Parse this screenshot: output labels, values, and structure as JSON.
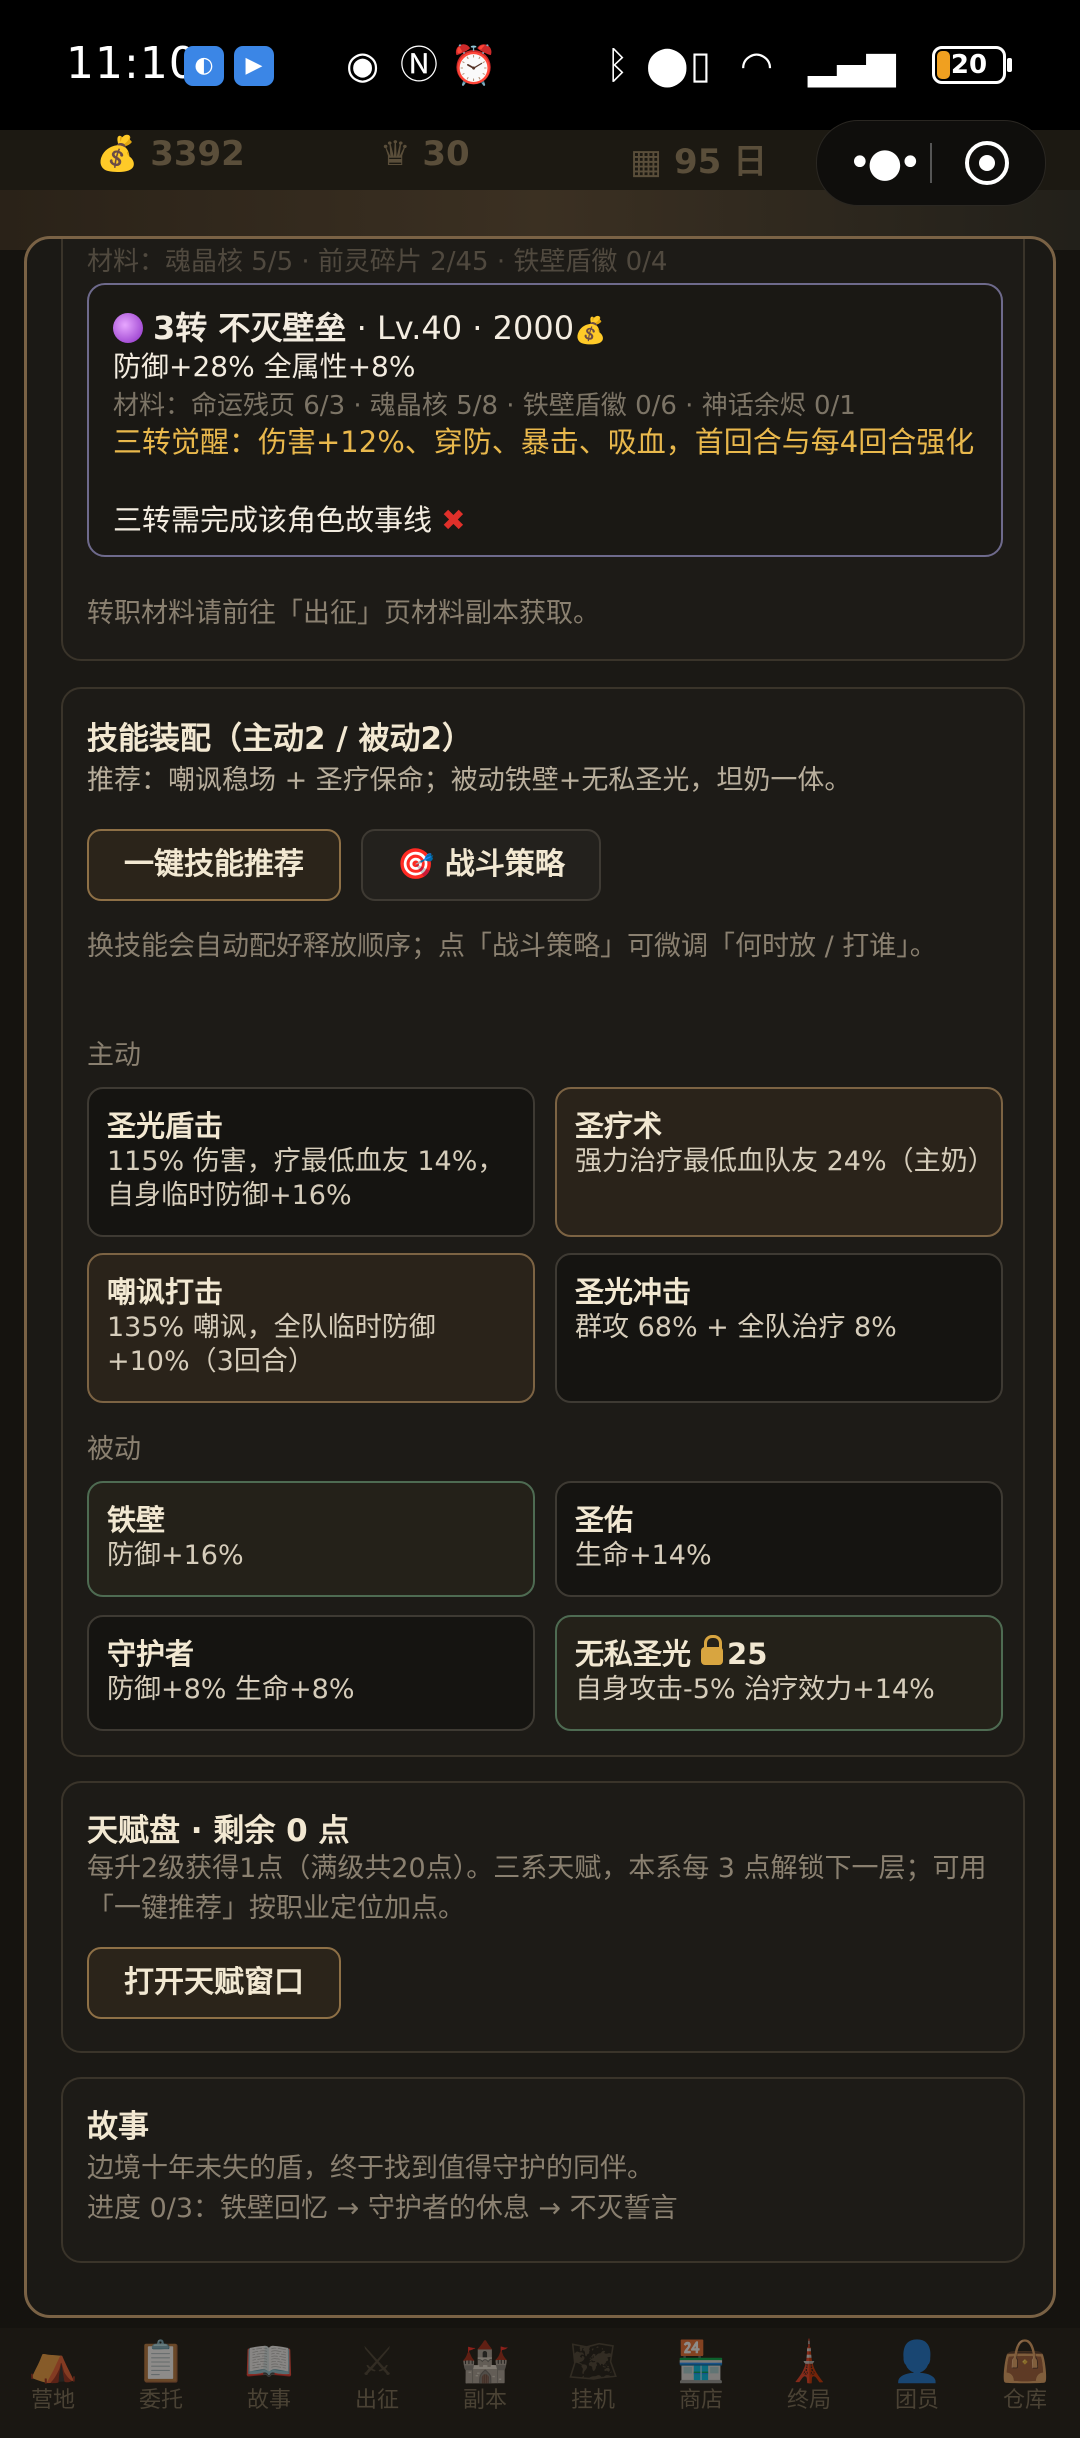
{
  "status_bar": {
    "time": "11:10",
    "battery": "20",
    "battery_level": 0.2,
    "icons": [
      "app-blue-icon",
      "app-blue-icon",
      "eye-icon",
      "nfc-icon",
      "alarm-icon",
      "bluetooth-icon",
      "location-icon",
      "vibrate-icon",
      "wifi-icon",
      "signal-icon",
      "signal-icon"
    ]
  },
  "resources": {
    "gold": "3392",
    "crown": "30",
    "day": "95",
    "day_unit": "日"
  },
  "top_card": {
    "cut_text": "材料：魂晶核 5/5 · 前灵碎片 2/45 · 铁壁盾徽 0/4",
    "title_tier": "3转 不灭壁垒",
    "title_rest": " · Lv.40 · 2000",
    "stats": "防御+28% 全属性+8%",
    "materials": "材料：命运残页 6/3 · 魂晶核 5/8 · 铁壁盾徽 0/6 · 神话余烬 0/1",
    "awakening": "三转觉醒：伤害+12%、穿防、暴击、吸血，首回合与每4回合强化",
    "requirement": "三转需完成该角色故事线",
    "note": "转职材料请前往「出征」页材料副本获取。"
  },
  "skills": {
    "heading": "技能装配（主动2 / 被动2）",
    "recommend": "推荐：嘲讽稳场 + 圣疗保命；被动铁壁+无私圣光，坦奶一体。",
    "btn_recommend": "一键技能推荐",
    "btn_strategy": "战斗策略",
    "hint": "换技能会自动配好释放顺序；点「战斗策略」可微调「何时放 / 打谁」。",
    "active_label": "主动",
    "passive_label": "被动",
    "active": [
      {
        "name": "圣光盾击",
        "desc": "115% 伤害，疗最低血友 14%，自身临时防御+16%"
      },
      {
        "name": "圣疗术",
        "desc": "强力治疗最低血队友 24%（主奶）"
      },
      {
        "name": "嘲讽打击",
        "desc": "135% 嘲讽，全队临时防御+10%（3回合）"
      },
      {
        "name": "圣光冲击",
        "desc": "群攻 68% + 全队治疗 8%"
      }
    ],
    "passive": [
      {
        "name": "铁壁",
        "desc": "防御+16%"
      },
      {
        "name": "圣佑",
        "desc": "生命+14%"
      },
      {
        "name": "守护者",
        "desc": "防御+8% 生命+8%"
      },
      {
        "name": "无私圣光",
        "level": "25",
        "desc": "自身攻击-5% 治疗效力+14%"
      }
    ]
  },
  "talent": {
    "heading": "天赋盘 · 剩余 0 点",
    "desc": "每升2级获得1点（满级共20点）。三系天赋，本系每 3 点解锁下一层；可用「一键推荐」按职业定位加点。",
    "btn": "打开天赋窗口"
  },
  "story": {
    "heading": "故事",
    "text": "边境十年未失的盾，终于找到值得守护的同伴。",
    "progress": "进度 0/3：铁壁回忆 → 守护者的休息 → 不灭誓言"
  },
  "bottom_nav": [
    {
      "label": "营地",
      "icon": "camp-icon"
    },
    {
      "label": "委托",
      "icon": "clipboard-icon"
    },
    {
      "label": "故事",
      "icon": "book-icon"
    },
    {
      "label": "出征",
      "icon": "swords-icon"
    },
    {
      "label": "副本",
      "icon": "castle-icon"
    },
    {
      "label": "挂机",
      "icon": "map-icon"
    },
    {
      "label": "商店",
      "icon": "shop-icon"
    },
    {
      "label": "终局",
      "icon": "tower-icon"
    },
    {
      "label": "团员",
      "icon": "member-icon"
    },
    {
      "label": "仓库",
      "icon": "bag-icon"
    }
  ],
  "colors": {
    "accent_gold": "#e9b84c",
    "panel_border": "#7a6245",
    "passive_green": "#4e6b52",
    "error_red": "#e0302a"
  }
}
